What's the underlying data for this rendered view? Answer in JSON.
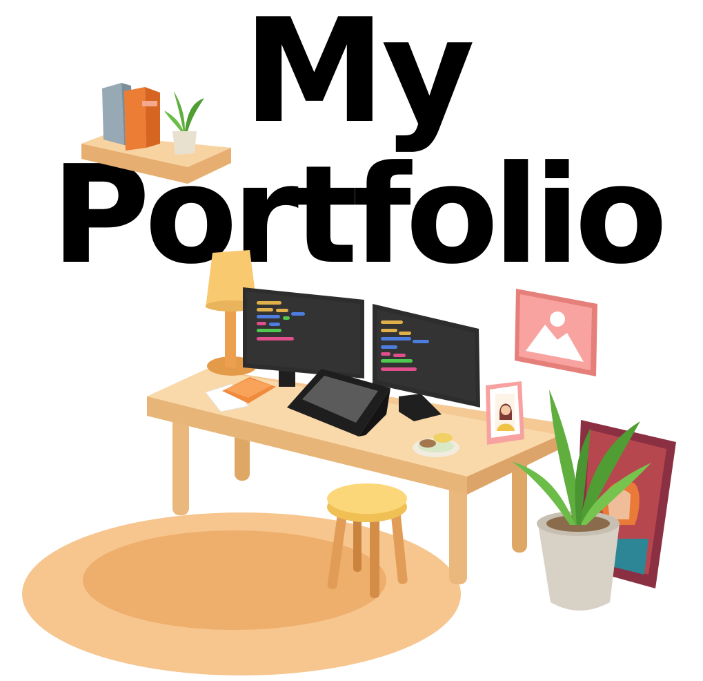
{
  "title": {
    "line1": "My",
    "line2": "Portfolio"
  },
  "colors": {
    "wood": "#f5c994",
    "wood_dark": "#e3a96a",
    "rug_outer": "#f7c58e",
    "rug_inner": "#eeae6c",
    "monitor": "#2d2d2d",
    "lamp_shade": "#f8c96e",
    "stool_seat": "#fbd77a",
    "plant_green": "#5fae3e",
    "pot": "#d8d2c6",
    "frame_pink": "#f59e9a",
    "portrait_frame": "#8b2f43",
    "code_yellow": "#e0b14a",
    "code_blue": "#4d7de0",
    "code_green": "#4fc84f",
    "code_pink": "#e04f8c"
  },
  "icons": {
    "shelf": "wall-shelf",
    "books": "books-icon",
    "lamp": "desk-lamp",
    "monitor_left": "monitor",
    "monitor_right": "monitor",
    "tablet": "drawing-tablet",
    "photo": "photo-frame",
    "plant": "potted-plant",
    "stool": "stool",
    "rug": "round-rug",
    "wall_picture": "image-placeholder-icon",
    "portrait": "portrait-painting"
  }
}
